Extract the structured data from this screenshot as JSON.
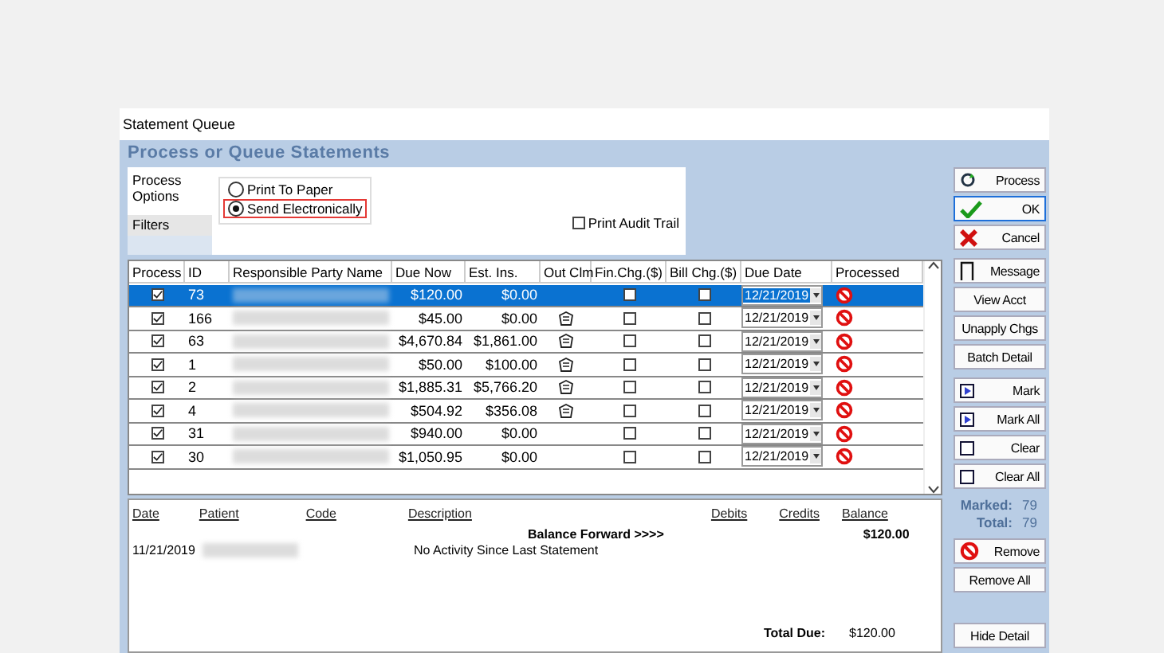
{
  "window": {
    "title": "Statement Queue"
  },
  "header": "Process or Queue Statements",
  "option_tabs": [
    {
      "label": "Process Options",
      "selected": true
    },
    {
      "label": "Filters",
      "selected": false
    }
  ],
  "output_options": [
    {
      "label": "Print To Paper",
      "selected": false,
      "highlighted": false
    },
    {
      "label": "Send Electronically",
      "selected": true,
      "highlighted": true
    }
  ],
  "audit_trail": {
    "label": "Print Audit Trail",
    "checked": false
  },
  "grid": {
    "columns": [
      "Process",
      "ID",
      "Responsible Party Name",
      "Due Now",
      "Est. Ins.",
      "Out Clm",
      "Fin.Chg.($)",
      "Bill Chg.($)",
      "Due Date",
      "Processed"
    ],
    "rows": [
      {
        "selected": true,
        "process": true,
        "id": "73",
        "due_now": "$120.00",
        "est_ins": "$0.00",
        "out_claim": false,
        "fin_chg": false,
        "bill_chg": false,
        "due_date": "12/21/2019"
      },
      {
        "selected": false,
        "process": true,
        "id": "166",
        "due_now": "$45.00",
        "est_ins": "$0.00",
        "out_claim": true,
        "fin_chg": false,
        "bill_chg": false,
        "due_date": "12/21/2019"
      },
      {
        "selected": false,
        "process": true,
        "id": "63",
        "due_now": "$4,670.84",
        "est_ins": "$1,861.00",
        "out_claim": true,
        "fin_chg": false,
        "bill_chg": false,
        "due_date": "12/21/2019"
      },
      {
        "selected": false,
        "process": true,
        "id": "1",
        "due_now": "$50.00",
        "est_ins": "$100.00",
        "out_claim": true,
        "fin_chg": false,
        "bill_chg": false,
        "due_date": "12/21/2019"
      },
      {
        "selected": false,
        "process": true,
        "id": "2",
        "due_now": "$1,885.31",
        "est_ins": "$5,766.20",
        "out_claim": true,
        "fin_chg": false,
        "bill_chg": false,
        "due_date": "12/21/2019"
      },
      {
        "selected": false,
        "process": true,
        "id": "4",
        "due_now": "$504.92",
        "est_ins": "$356.08",
        "out_claim": true,
        "fin_chg": false,
        "bill_chg": false,
        "due_date": "12/21/2019"
      },
      {
        "selected": false,
        "process": true,
        "id": "31",
        "due_now": "$940.00",
        "est_ins": "$0.00",
        "out_claim": false,
        "fin_chg": false,
        "bill_chg": false,
        "due_date": "12/21/2019"
      },
      {
        "selected": false,
        "process": true,
        "id": "30",
        "due_now": "$1,050.95",
        "est_ins": "$0.00",
        "out_claim": false,
        "fin_chg": false,
        "bill_chg": false,
        "due_date": "12/21/2019"
      }
    ]
  },
  "detail": {
    "columns": [
      "Date",
      "Patient",
      "Code",
      "Description",
      "Debits",
      "Credits",
      "Balance"
    ],
    "balance_forward": {
      "label": "Balance Forward >>>>",
      "balance": "$120.00"
    },
    "rows": [
      {
        "date": "11/21/2019",
        "description": "No Activity Since Last Statement"
      }
    ],
    "total": {
      "label": "Total Due:",
      "value": "$120.00"
    }
  },
  "side_buttons": [
    [
      {
        "kind": "process",
        "label": "Process",
        "focused": false
      },
      {
        "kind": "ok",
        "label": "OK",
        "focused": true
      },
      {
        "kind": "cancel",
        "label": "Cancel",
        "focused": false
      }
    ],
    [
      {
        "kind": "message",
        "label": "Message",
        "focused": false
      },
      {
        "kind": "plain",
        "label": "View Acct",
        "focused": false
      },
      {
        "kind": "plain",
        "label": "Unapply Chgs",
        "focused": false
      },
      {
        "kind": "plain",
        "label": "Batch Detail",
        "focused": false
      }
    ],
    [
      {
        "kind": "mark",
        "label": "Mark",
        "focused": false
      },
      {
        "kind": "mark",
        "label": "Mark All",
        "focused": false
      },
      {
        "kind": "clear",
        "label": "Clear",
        "focused": false
      },
      {
        "kind": "clear",
        "label": "Clear All",
        "focused": false
      }
    ]
  ],
  "counts": [
    {
      "label": "Marked:",
      "value": "79"
    },
    {
      "label": "Total:",
      "value": "79"
    }
  ],
  "remove_buttons": [
    {
      "kind": "remove",
      "label": "Remove",
      "focused": false
    },
    {
      "kind": "plain",
      "label": "Remove All",
      "focused": false
    }
  ],
  "hide_button": {
    "label": "Hide Detail"
  }
}
